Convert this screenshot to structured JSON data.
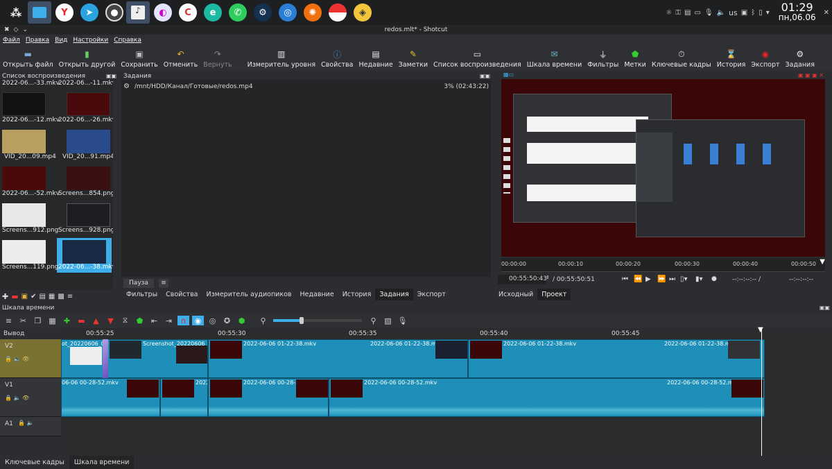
{
  "taskbar": {
    "apps": [
      "menu-icon",
      "files-icon",
      "yandex-browser-icon",
      "telegram-icon",
      "obs-icon",
      "audio-mixer-icon",
      "krita-icon",
      "browser-c-icon",
      "microsoft-edge-dev-icon",
      "whatsapp-icon",
      "steam-icon",
      "network-tool-icon",
      "fan-app-icon",
      "pokeball-icon",
      "wallet-icon"
    ],
    "tray": {
      "keyboard_layout": "us",
      "clock_time": "01:29",
      "clock_date": "пн,06.06"
    }
  },
  "window": {
    "title": "redos.mlt* - Shotcut"
  },
  "menu": {
    "items": [
      "Файл",
      "Правка",
      "Вид",
      "Настройки",
      "Справка"
    ]
  },
  "toolbar": {
    "open_file": "Открыть файл",
    "open_other": "Открыть другой",
    "save": "Сохранить",
    "undo": "Отменить",
    "redo": "Вернуть",
    "level_meter": "Измеритель уровня",
    "properties": "Свойства",
    "recent": "Недавние",
    "notes": "Заметки",
    "playlist": "Список воспроизведения",
    "timeline": "Шкала времени",
    "filters": "Фильтры",
    "markers": "Метки",
    "keyframes": "Ключевые кадры",
    "history": "История",
    "export": "Экспорт",
    "jobs": "Задания"
  },
  "playlist": {
    "title": "Список воспроизведения",
    "items": [
      {
        "label": "2022-06...-33.mkv"
      },
      {
        "label": "2022-06...-11.mkv"
      },
      {
        "label": "2022-06...-12.mkv"
      },
      {
        "label": "2022-06...-26.mkv"
      },
      {
        "label": "VID_20...09.mp4"
      },
      {
        "label": "VID_20...91.mp4"
      },
      {
        "label": "2022-06...-52.mkv"
      },
      {
        "label": "Screens...854.png"
      },
      {
        "label": "Screens...912.png"
      },
      {
        "label": "Screens...928.png"
      },
      {
        "label": "Screens...119.png"
      },
      {
        "label": "2022-06...-38.mkv"
      }
    ]
  },
  "jobs": {
    "title": "Задания",
    "job_path": "/mnt/HDD/Канал/Готовые/redos.mp4",
    "job_progress": "3% (02:43:22)",
    "pause_label": "Пауза"
  },
  "left_tabs": [
    "Фильтры",
    "Свойства",
    "Измеритель аудиопиков",
    "Недавние",
    "История",
    "Задания",
    "Экспорт"
  ],
  "player": {
    "ruler_ticks": [
      "00:00:00",
      "00:00:10",
      "00:00:20",
      "00:00:30",
      "00:00:40",
      "00:00:50"
    ],
    "current_time": "00:55:50:43",
    "total_time": "/ 00:55:50:51",
    "in_point": "--:--:--:-- /",
    "out_point": "--:--:--:--",
    "source_tab": "Исходный",
    "project_tab": "Проект"
  },
  "timeline": {
    "title": "Шкала времени",
    "ruler_ticks": [
      "00:55:25",
      "00:55:30",
      "00:55:35",
      "00:55:40",
      "00:55:45"
    ],
    "output_label": "Вывод",
    "tracks": [
      {
        "name": "V2"
      },
      {
        "name": "V1"
      },
      {
        "name": "A1"
      }
    ],
    "v2_clips": [
      "ot_20220606_012",
      "Screenshot_20220606_01",
      "2022-06-06 01-22-38.mkv",
      "2022-06-06 01-22-38.mkv",
      "2022-06-06 01-22-38.mkv",
      "2022-06-06 01-22-38.mkv"
    ],
    "v1_clips": [
      "06-06 00-28-52.mkv",
      "2022",
      "2022-06-06 00-28-52.mkv",
      "2022-06-06 00-28-52.mkv",
      "2022-06-06 00-28-52.mkv"
    ]
  },
  "bottom_tabs": [
    "Ключевые кадры",
    "Шкала времени"
  ],
  "colors": {
    "accent": "#3daee9",
    "clip": "#1d8fb8",
    "v2_track_bg": "#7a7232",
    "preview_bg": "#3a0608"
  }
}
